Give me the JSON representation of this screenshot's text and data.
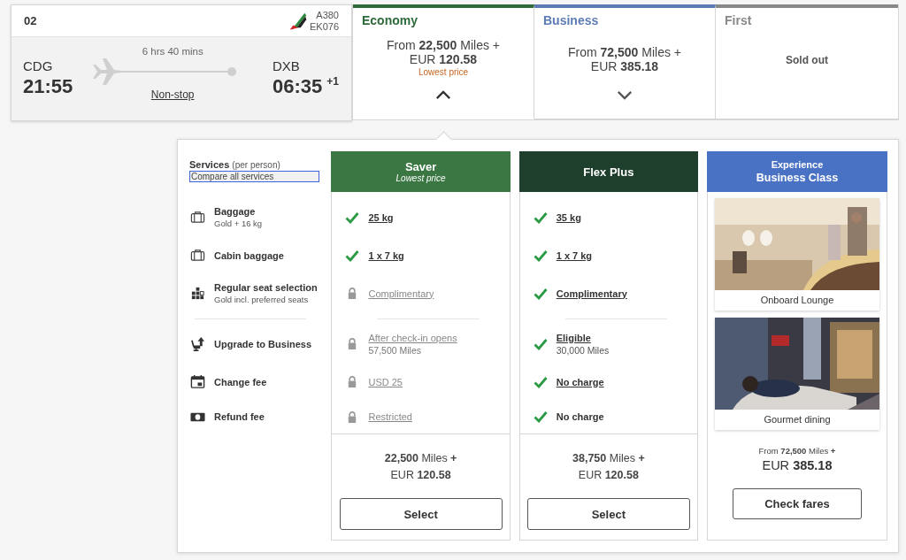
{
  "flight": {
    "number": "02",
    "aircraft": "A380",
    "flight_code": "EK076",
    "origin": {
      "code": "CDG",
      "time": "21:55"
    },
    "destination": {
      "code": "DXB",
      "time": "06:35",
      "day_offset": "+1"
    },
    "duration": "6 hrs 40 mins",
    "stops": "Non-stop"
  },
  "cabins": [
    {
      "name": "Economy",
      "color": "#2f6b3a",
      "kind": "price",
      "price": "From **22,500** Miles +",
      "price2": "EUR **120.58**",
      "note": "Lowest price",
      "expanded": true,
      "selected": true
    },
    {
      "name": "Business",
      "color": "#5b7bb5",
      "kind": "price",
      "price": "From **72,500** Miles +",
      "price2": "EUR **385.18**",
      "expanded": false,
      "selected": false
    },
    {
      "name": "First",
      "color": "#888888",
      "kind": "sold_out",
      "price": "Sold out",
      "selected": false
    }
  ],
  "services": {
    "heading": "Services",
    "heading_note": "(per person)",
    "compare_link": "Compare all services",
    "items": [
      {
        "kind": "baggage",
        "label": "Baggage",
        "detail": "Gold + 16 kg"
      },
      {
        "kind": "cabin",
        "label": "Cabin baggage"
      },
      {
        "kind": "seat",
        "label": "Regular seat selection",
        "detail": "Gold incl. preferred seats"
      },
      {
        "kind": "upgrade",
        "label": "Upgrade to Business"
      },
      {
        "kind": "change",
        "label": "Change fee"
      },
      {
        "kind": "refund",
        "label": "Refund fee"
      }
    ]
  },
  "fares": [
    {
      "name": "Saver",
      "subtitle": "Lowest price",
      "color": "#3a7743",
      "cells": [
        {
          "text": "25 kg",
          "included": true,
          "link": true
        },
        {
          "text": "1 x 7 kg",
          "included": true,
          "link": true
        },
        {
          "text": "Complimentary",
          "included": false,
          "link": true
        },
        {
          "text": "After check-in opens",
          "detail": "57,500 Miles",
          "included": false,
          "link": true
        },
        {
          "text": "USD 25",
          "included": false,
          "link": true
        },
        {
          "text": "Restricted",
          "included": false,
          "link": true
        }
      ],
      "miles": "**22,500** Miles **+**",
      "eur": "EUR **120.58**",
      "button": "Select"
    },
    {
      "name": "Flex Plus",
      "color": "#1e3f2c",
      "cells": [
        {
          "text": "35 kg",
          "included": true,
          "link": true
        },
        {
          "text": "1 x 7 kg",
          "included": true,
          "link": true
        },
        {
          "text": "Complimentary",
          "included": true,
          "link": true
        },
        {
          "text": "Eligible",
          "detail": "30,000 Miles",
          "included": true,
          "link": true
        },
        {
          "text": "No charge",
          "included": true,
          "link": true
        },
        {
          "text": "No charge",
          "included": true,
          "link": false
        }
      ],
      "miles": "**38,750** Miles **+**",
      "eur": "EUR **120.58**",
      "button": "Select"
    }
  ],
  "promo": {
    "title": "Experience",
    "subtitle": "Business Class",
    "color": "#4a72c4",
    "pictures": [
      {
        "kind": "picture",
        "caption": "Onboard Lounge"
      },
      {
        "kind": "picture",
        "caption": "Gourmet dining"
      }
    ],
    "price_line": "From **72,500** Miles **+**",
    "price": "EUR **385.18**",
    "button": "Check fares"
  }
}
